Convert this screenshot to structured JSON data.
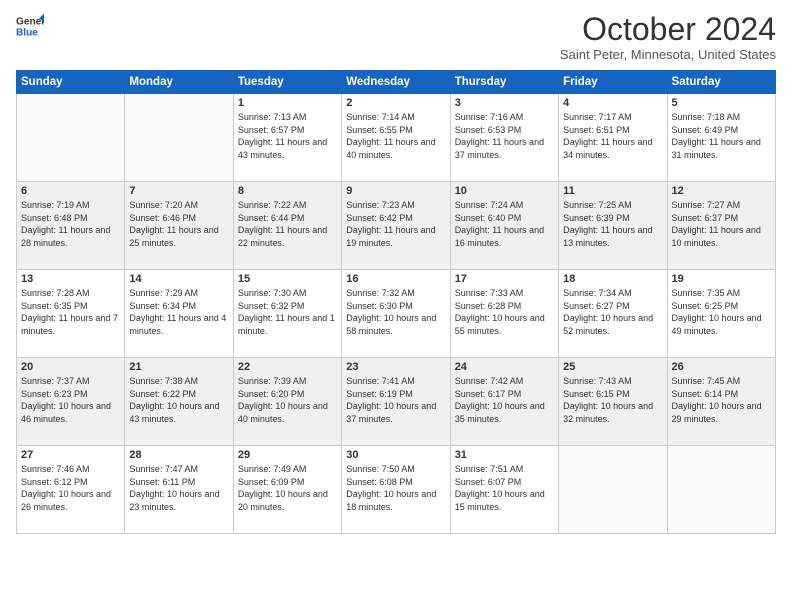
{
  "header": {
    "logo_line1": "General",
    "logo_line2": "Blue",
    "title": "October 2024",
    "subtitle": "Saint Peter, Minnesota, United States"
  },
  "weekdays": [
    "Sunday",
    "Monday",
    "Tuesday",
    "Wednesday",
    "Thursday",
    "Friday",
    "Saturday"
  ],
  "weeks": [
    [
      {
        "day": "",
        "empty": true
      },
      {
        "day": "",
        "empty": true
      },
      {
        "day": "1",
        "sunrise": "Sunrise: 7:13 AM",
        "sunset": "Sunset: 6:57 PM",
        "daylight": "Daylight: 11 hours and 43 minutes."
      },
      {
        "day": "2",
        "sunrise": "Sunrise: 7:14 AM",
        "sunset": "Sunset: 6:55 PM",
        "daylight": "Daylight: 11 hours and 40 minutes."
      },
      {
        "day": "3",
        "sunrise": "Sunrise: 7:16 AM",
        "sunset": "Sunset: 6:53 PM",
        "daylight": "Daylight: 11 hours and 37 minutes."
      },
      {
        "day": "4",
        "sunrise": "Sunrise: 7:17 AM",
        "sunset": "Sunset: 6:51 PM",
        "daylight": "Daylight: 11 hours and 34 minutes."
      },
      {
        "day": "5",
        "sunrise": "Sunrise: 7:18 AM",
        "sunset": "Sunset: 6:49 PM",
        "daylight": "Daylight: 11 hours and 31 minutes."
      }
    ],
    [
      {
        "day": "6",
        "sunrise": "Sunrise: 7:19 AM",
        "sunset": "Sunset: 6:48 PM",
        "daylight": "Daylight: 11 hours and 28 minutes."
      },
      {
        "day": "7",
        "sunrise": "Sunrise: 7:20 AM",
        "sunset": "Sunset: 6:46 PM",
        "daylight": "Daylight: 11 hours and 25 minutes."
      },
      {
        "day": "8",
        "sunrise": "Sunrise: 7:22 AM",
        "sunset": "Sunset: 6:44 PM",
        "daylight": "Daylight: 11 hours and 22 minutes."
      },
      {
        "day": "9",
        "sunrise": "Sunrise: 7:23 AM",
        "sunset": "Sunset: 6:42 PM",
        "daylight": "Daylight: 11 hours and 19 minutes."
      },
      {
        "day": "10",
        "sunrise": "Sunrise: 7:24 AM",
        "sunset": "Sunset: 6:40 PM",
        "daylight": "Daylight: 11 hours and 16 minutes."
      },
      {
        "day": "11",
        "sunrise": "Sunrise: 7:25 AM",
        "sunset": "Sunset: 6:39 PM",
        "daylight": "Daylight: 11 hours and 13 minutes."
      },
      {
        "day": "12",
        "sunrise": "Sunrise: 7:27 AM",
        "sunset": "Sunset: 6:37 PM",
        "daylight": "Daylight: 11 hours and 10 minutes."
      }
    ],
    [
      {
        "day": "13",
        "sunrise": "Sunrise: 7:28 AM",
        "sunset": "Sunset: 6:35 PM",
        "daylight": "Daylight: 11 hours and 7 minutes."
      },
      {
        "day": "14",
        "sunrise": "Sunrise: 7:29 AM",
        "sunset": "Sunset: 6:34 PM",
        "daylight": "Daylight: 11 hours and 4 minutes."
      },
      {
        "day": "15",
        "sunrise": "Sunrise: 7:30 AM",
        "sunset": "Sunset: 6:32 PM",
        "daylight": "Daylight: 11 hours and 1 minute."
      },
      {
        "day": "16",
        "sunrise": "Sunrise: 7:32 AM",
        "sunset": "Sunset: 6:30 PM",
        "daylight": "Daylight: 10 hours and 58 minutes."
      },
      {
        "day": "17",
        "sunrise": "Sunrise: 7:33 AM",
        "sunset": "Sunset: 6:28 PM",
        "daylight": "Daylight: 10 hours and 55 minutes."
      },
      {
        "day": "18",
        "sunrise": "Sunrise: 7:34 AM",
        "sunset": "Sunset: 6:27 PM",
        "daylight": "Daylight: 10 hours and 52 minutes."
      },
      {
        "day": "19",
        "sunrise": "Sunrise: 7:35 AM",
        "sunset": "Sunset: 6:25 PM",
        "daylight": "Daylight: 10 hours and 49 minutes."
      }
    ],
    [
      {
        "day": "20",
        "sunrise": "Sunrise: 7:37 AM",
        "sunset": "Sunset: 6:23 PM",
        "daylight": "Daylight: 10 hours and 46 minutes."
      },
      {
        "day": "21",
        "sunrise": "Sunrise: 7:38 AM",
        "sunset": "Sunset: 6:22 PM",
        "daylight": "Daylight: 10 hours and 43 minutes."
      },
      {
        "day": "22",
        "sunrise": "Sunrise: 7:39 AM",
        "sunset": "Sunset: 6:20 PM",
        "daylight": "Daylight: 10 hours and 40 minutes."
      },
      {
        "day": "23",
        "sunrise": "Sunrise: 7:41 AM",
        "sunset": "Sunset: 6:19 PM",
        "daylight": "Daylight: 10 hours and 37 minutes."
      },
      {
        "day": "24",
        "sunrise": "Sunrise: 7:42 AM",
        "sunset": "Sunset: 6:17 PM",
        "daylight": "Daylight: 10 hours and 35 minutes."
      },
      {
        "day": "25",
        "sunrise": "Sunrise: 7:43 AM",
        "sunset": "Sunset: 6:15 PM",
        "daylight": "Daylight: 10 hours and 32 minutes."
      },
      {
        "day": "26",
        "sunrise": "Sunrise: 7:45 AM",
        "sunset": "Sunset: 6:14 PM",
        "daylight": "Daylight: 10 hours and 29 minutes."
      }
    ],
    [
      {
        "day": "27",
        "sunrise": "Sunrise: 7:46 AM",
        "sunset": "Sunset: 6:12 PM",
        "daylight": "Daylight: 10 hours and 26 minutes."
      },
      {
        "day": "28",
        "sunrise": "Sunrise: 7:47 AM",
        "sunset": "Sunset: 6:11 PM",
        "daylight": "Daylight: 10 hours and 23 minutes."
      },
      {
        "day": "29",
        "sunrise": "Sunrise: 7:49 AM",
        "sunset": "Sunset: 6:09 PM",
        "daylight": "Daylight: 10 hours and 20 minutes."
      },
      {
        "day": "30",
        "sunrise": "Sunrise: 7:50 AM",
        "sunset": "Sunset: 6:08 PM",
        "daylight": "Daylight: 10 hours and 18 minutes."
      },
      {
        "day": "31",
        "sunrise": "Sunrise: 7:51 AM",
        "sunset": "Sunset: 6:07 PM",
        "daylight": "Daylight: 10 hours and 15 minutes."
      },
      {
        "day": "",
        "empty": true
      },
      {
        "day": "",
        "empty": true
      }
    ]
  ]
}
